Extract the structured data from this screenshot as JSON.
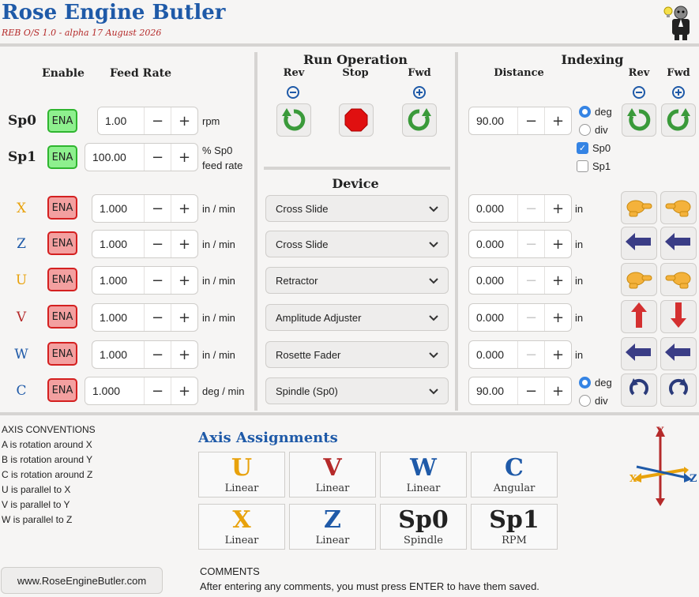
{
  "app": {
    "title": "Rose Engine Butler",
    "subtitle": "REB O/S 1.0 - alpha 17 August 2026"
  },
  "headers": {
    "enable": "Enable",
    "feed_rate": "Feed Rate",
    "run_operation": "Run Operation",
    "rev": "Rev",
    "stop": "Stop",
    "fwd": "Fwd",
    "device": "Device",
    "indexing": "Indexing",
    "distance": "Distance",
    "idx_rev": "Rev",
    "idx_fwd": "Fwd"
  },
  "spindles": [
    {
      "label": "Sp0",
      "ena": "ENA",
      "feed": "1.00",
      "unit": "rpm"
    },
    {
      "label": "Sp1",
      "ena": "ENA",
      "feed": "100.00",
      "unit_line1": "% Sp0",
      "unit_line2": "feed rate"
    }
  ],
  "spindle_index": {
    "distance": "90.00",
    "deg_label": "deg",
    "div_label": "div",
    "mode": "deg",
    "sp0_label": "Sp0",
    "sp0_checked": true,
    "sp1_label": "Sp1",
    "sp1_checked": false
  },
  "axes": [
    {
      "label": "X",
      "color": "#e8a20c",
      "ena": "ENA",
      "feed": "1.000",
      "unit": "in / min",
      "device": "Cross Slide",
      "distance": "0.000",
      "dist_unit": "in",
      "icon": "hand-pointer-icon"
    },
    {
      "label": "Z",
      "color": "#1f5aa8",
      "ena": "ENA",
      "feed": "1.000",
      "unit": "in / min",
      "device": "Cross Slide",
      "distance": "0.000",
      "dist_unit": "in",
      "icon": "arrow-icon"
    },
    {
      "label": "U",
      "color": "#e8a20c",
      "ena": "ENA",
      "feed": "1.000",
      "unit": "in / min",
      "device": "Retractor",
      "distance": "0.000",
      "dist_unit": "in",
      "icon": "hand-pointer-icon"
    },
    {
      "label": "V",
      "color": "#b52a2a",
      "ena": "ENA",
      "feed": "1.000",
      "unit": "in / min",
      "device": "Amplitude Adjuster",
      "distance": "0.000",
      "dist_unit": "in",
      "icon": "arrow-vertical-icon"
    },
    {
      "label": "W",
      "color": "#1f5aa8",
      "ena": "ENA",
      "feed": "1.000",
      "unit": "in / min",
      "device": "Rosette Fader",
      "distance": "0.000",
      "dist_unit": "in",
      "icon": "arrow-icon"
    },
    {
      "label": "C",
      "color": "#1f5aa8",
      "ena": "ENA",
      "feed": "1.000",
      "unit": "deg / min",
      "device": "Spindle (Sp0)",
      "distance": "90.00",
      "dist_unit": "",
      "icon": "rotate-icon"
    }
  ],
  "c_index": {
    "deg_label": "deg",
    "div_label": "div",
    "mode": "deg"
  },
  "conventions": {
    "title": "AXIS CONVENTIONS",
    "lines": [
      "A is rotation around X",
      "B is rotation around Y",
      "C is rotation around Z",
      "U is parallel to X",
      "V is parallel to Y",
      "W is parallel to Z"
    ]
  },
  "assignments": {
    "title": "Axis Assignments",
    "cards": [
      {
        "letter": "U",
        "kind": "Linear",
        "color": "#e8a20c"
      },
      {
        "letter": "V",
        "kind": "Linear",
        "color": "#b52a2a"
      },
      {
        "letter": "W",
        "kind": "Linear",
        "color": "#1f5aa8"
      },
      {
        "letter": "C",
        "kind": "Angular",
        "color": "#1f5aa8"
      },
      {
        "letter": "X",
        "kind": "Linear",
        "color": "#e8a20c"
      },
      {
        "letter": "Z",
        "kind": "Linear",
        "color": "#1f5aa8"
      },
      {
        "letter": "Sp0",
        "kind": "Spindle",
        "color": "#222222"
      },
      {
        "letter": "Sp1",
        "kind": "RPM",
        "color": "#222222"
      }
    ]
  },
  "axis_diagram": {
    "y": "Y",
    "x": "X",
    "z": "Z"
  },
  "footer": {
    "url_button": "www.RoseEngineButler.com",
    "comments_title": "COMMENTS",
    "comments_hint": "After entering any comments, you must press ENTER to have them saved."
  },
  "colors": {
    "accent": "#1f5aa8",
    "ena_green": "#8ef08e",
    "ena_red": "#f3a0a0",
    "rotate_green": "#3a9a3a",
    "stop_red": "#e01010",
    "arrow_blue": "#3a3d86",
    "hand_yellow": "#f4b23b",
    "arrow_red": "#d43030"
  }
}
